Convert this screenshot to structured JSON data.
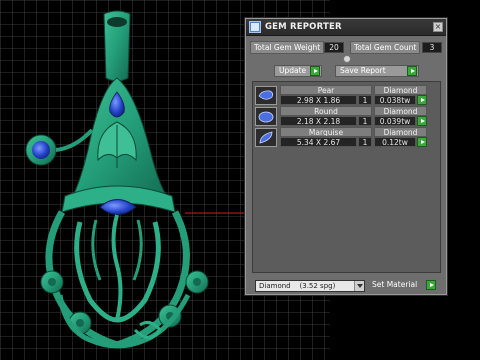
{
  "panel": {
    "title": "GEM REPORTER",
    "close_glyph": "×",
    "total_weight_label": "Total Gem Weight",
    "total_weight_value": "20",
    "total_count_label": "Total Gem Count",
    "total_count_value": "3",
    "update_label": "Update",
    "save_report_label": "Save Report",
    "set_material_label": "Set Material",
    "material_value": "Diamond    (3.52 spg)"
  },
  "gems": [
    {
      "shape": "Pear",
      "size": "2.98 X 1.86",
      "material": "Diamond",
      "qty": "1",
      "weight": "0.038tw",
      "icon": "pear-gem-icon"
    },
    {
      "shape": "Round",
      "size": "2.18 X 2.18",
      "material": "Diamond",
      "qty": "1",
      "weight": "0.039tw",
      "icon": "round-gem-icon"
    },
    {
      "shape": "Marquise",
      "size": "5.34 X 2.67",
      "material": "Diamond",
      "qty": "1",
      "weight": "0.12tw",
      "icon": "marquise-gem-icon"
    }
  ],
  "colors": {
    "viewport_bg": "#000000",
    "grid_line": "#5a5a5a",
    "model_green": "#2a9a78",
    "gem_blue": "#2c4fd0",
    "go_button_green": "#3aa83a"
  }
}
